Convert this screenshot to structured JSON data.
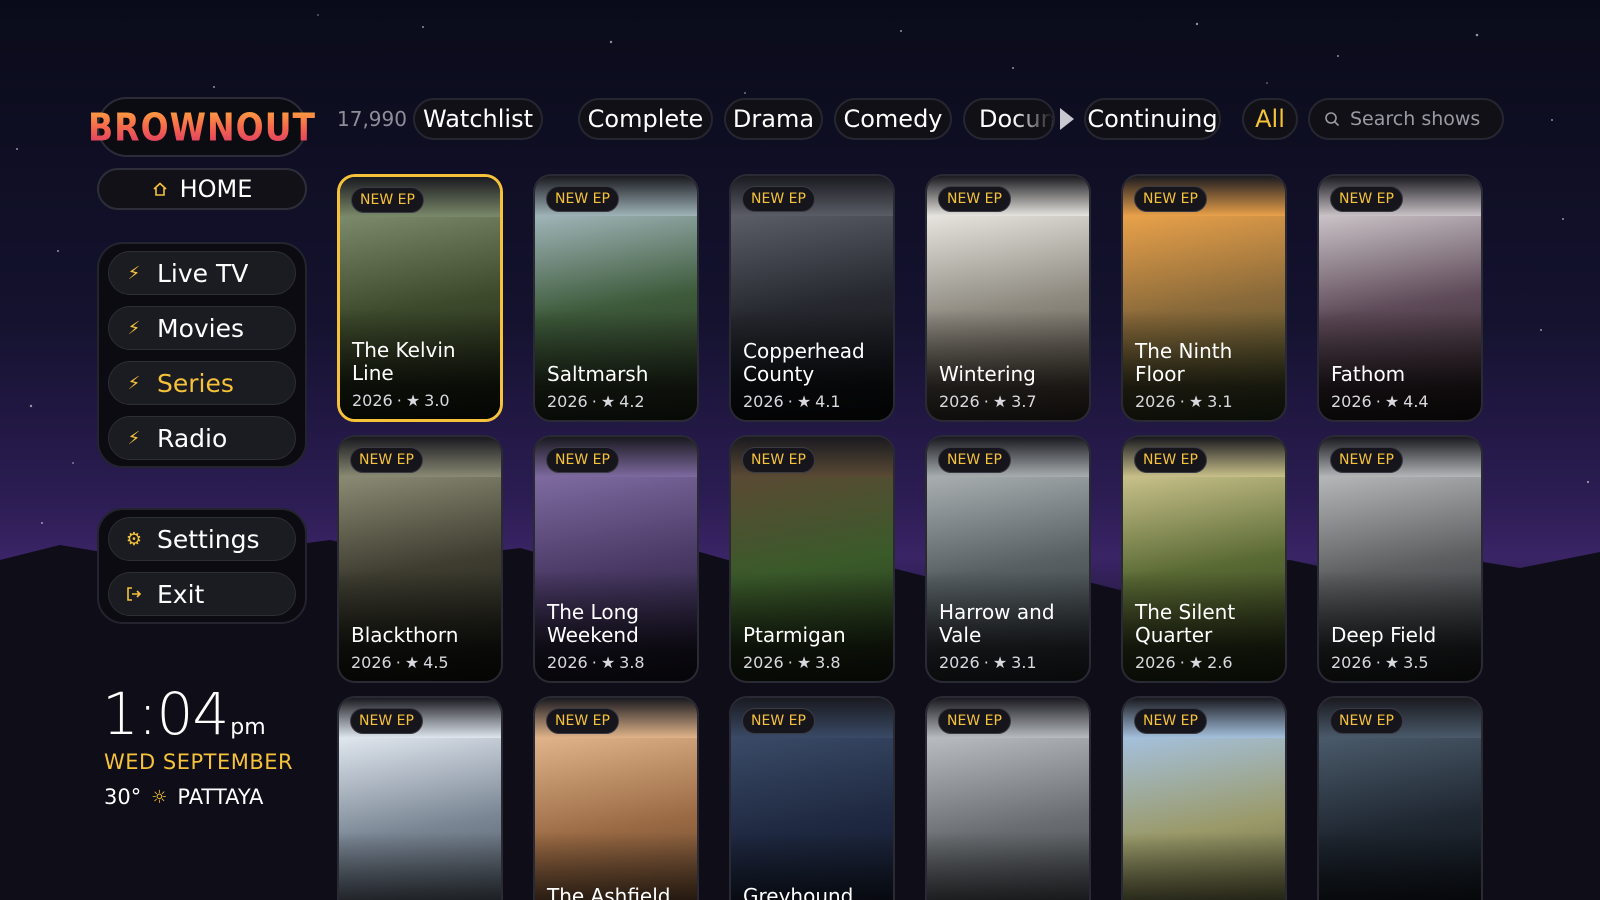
{
  "app": {
    "logo_text": "BROWNOUT"
  },
  "sidebar": {
    "home_label": "HOME",
    "main_items": [
      {
        "label": "Live TV",
        "icon": "bolt-icon",
        "active": false
      },
      {
        "label": "Movies",
        "icon": "bolt-icon",
        "active": false
      },
      {
        "label": "Series",
        "icon": "bolt-icon",
        "active": true
      },
      {
        "label": "Radio",
        "icon": "bolt-icon",
        "active": false
      }
    ],
    "system_items": [
      {
        "label": "Settings",
        "icon": "gear-icon"
      },
      {
        "label": "Exit",
        "icon": "exit-icon"
      }
    ]
  },
  "status": {
    "time": "1:04",
    "ampm": "pm",
    "date": "WED SEPTEMBER",
    "temperature": "30°",
    "city": "PATTAYA"
  },
  "filters": {
    "count": "17,990",
    "chips": [
      {
        "label": "Watchlist",
        "active": false
      },
      {
        "label": "Complete",
        "active": false
      },
      {
        "label": "Drama",
        "active": false
      },
      {
        "label": "Comedy",
        "active": false
      },
      {
        "label": "Docum",
        "active": false
      },
      {
        "label": "Continuing",
        "active": false
      },
      {
        "label": "All",
        "active": true
      }
    ],
    "search_placeholder": "Search shows"
  },
  "badge_label": "NEW EP",
  "cards": [
    {
      "title": "The Kelvin Line",
      "year": "2026",
      "rating": "3.0",
      "focused": true
    },
    {
      "title": "Saltmarsh",
      "year": "2026",
      "rating": "4.2"
    },
    {
      "title": "Copperhead County",
      "year": "2026",
      "rating": "4.1"
    },
    {
      "title": "Wintering",
      "year": "2026",
      "rating": "3.7"
    },
    {
      "title": "The Ninth Floor",
      "year": "2026",
      "rating": "3.1"
    },
    {
      "title": "Fathom",
      "year": "2026",
      "rating": "4.4"
    },
    {
      "title": "Blackthorn",
      "year": "2026",
      "rating": "4.5"
    },
    {
      "title": "The Long Weekend",
      "year": "2026",
      "rating": "3.8"
    },
    {
      "title": "Ptarmigan",
      "year": "2026",
      "rating": "3.8"
    },
    {
      "title": "Harrow and Vale",
      "year": "2026",
      "rating": "3.1"
    },
    {
      "title": "The Silent Quarter",
      "year": "2026",
      "rating": "2.6"
    },
    {
      "title": "Deep Field",
      "year": "2026",
      "rating": "3.5"
    },
    {
      "title": "",
      "year": "",
      "rating": ""
    },
    {
      "title": "The Ashfield",
      "year": "",
      "rating": ""
    },
    {
      "title": "Greyhound",
      "year": "",
      "rating": ""
    },
    {
      "title": "",
      "year": "",
      "rating": ""
    },
    {
      "title": "",
      "year": "",
      "rating": ""
    },
    {
      "title": "",
      "year": "",
      "rating": ""
    }
  ]
}
